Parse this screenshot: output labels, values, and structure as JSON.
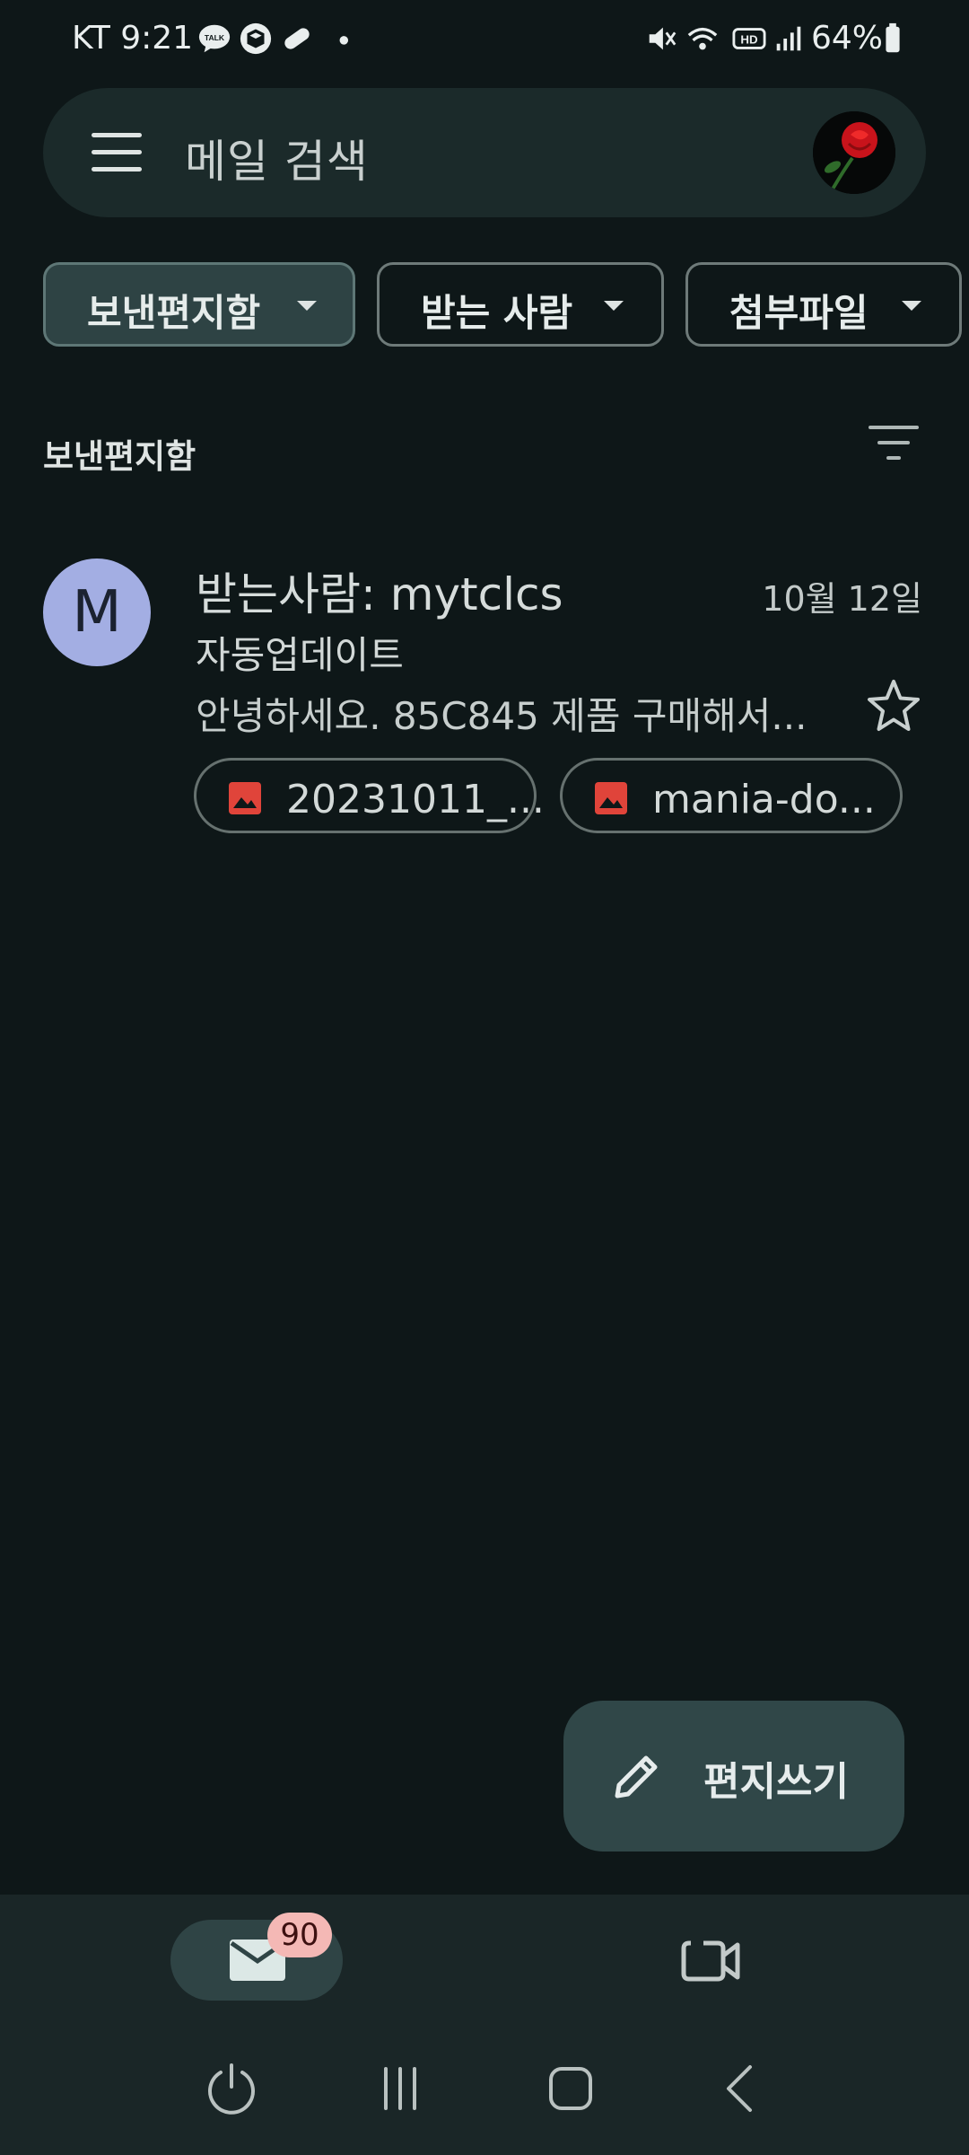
{
  "status_bar": {
    "carrier_time": "KT 9:21",
    "battery": "64%"
  },
  "search": {
    "placeholder": "메일 검색"
  },
  "chips": [
    {
      "label": "보낸편지함"
    },
    {
      "label": "받는 사람"
    },
    {
      "label": "첨부파일"
    }
  ],
  "section": {
    "title": "보낸편지함"
  },
  "mail": {
    "avatar_letter": "M",
    "sender": "받는사람: mytclcs",
    "date": "10월 12일",
    "subject": "자동업데이트",
    "snippet": "안녕하세요. 85C845 제품 구매해서...",
    "attachments": [
      {
        "name": "20231011_..."
      },
      {
        "name": "mania-do..."
      }
    ]
  },
  "compose": {
    "label": "편지쓰기"
  },
  "bottom_nav": {
    "mail_badge": "90"
  },
  "colors": {
    "background": "#0e1718",
    "search_bar": "#1b2a2a",
    "active_chip": "#2e4344",
    "avatar": "#a3aee3",
    "attachment_icon": "#e0443a",
    "badge": "#f4b8b5"
  },
  "icons": [
    "menu-icon",
    "profile-avatar",
    "filter-icon",
    "star-icon",
    "image-icon",
    "pencil-icon",
    "mail-icon",
    "video-icon",
    "power-icon",
    "recents-icon",
    "home-icon",
    "back-icon"
  ]
}
